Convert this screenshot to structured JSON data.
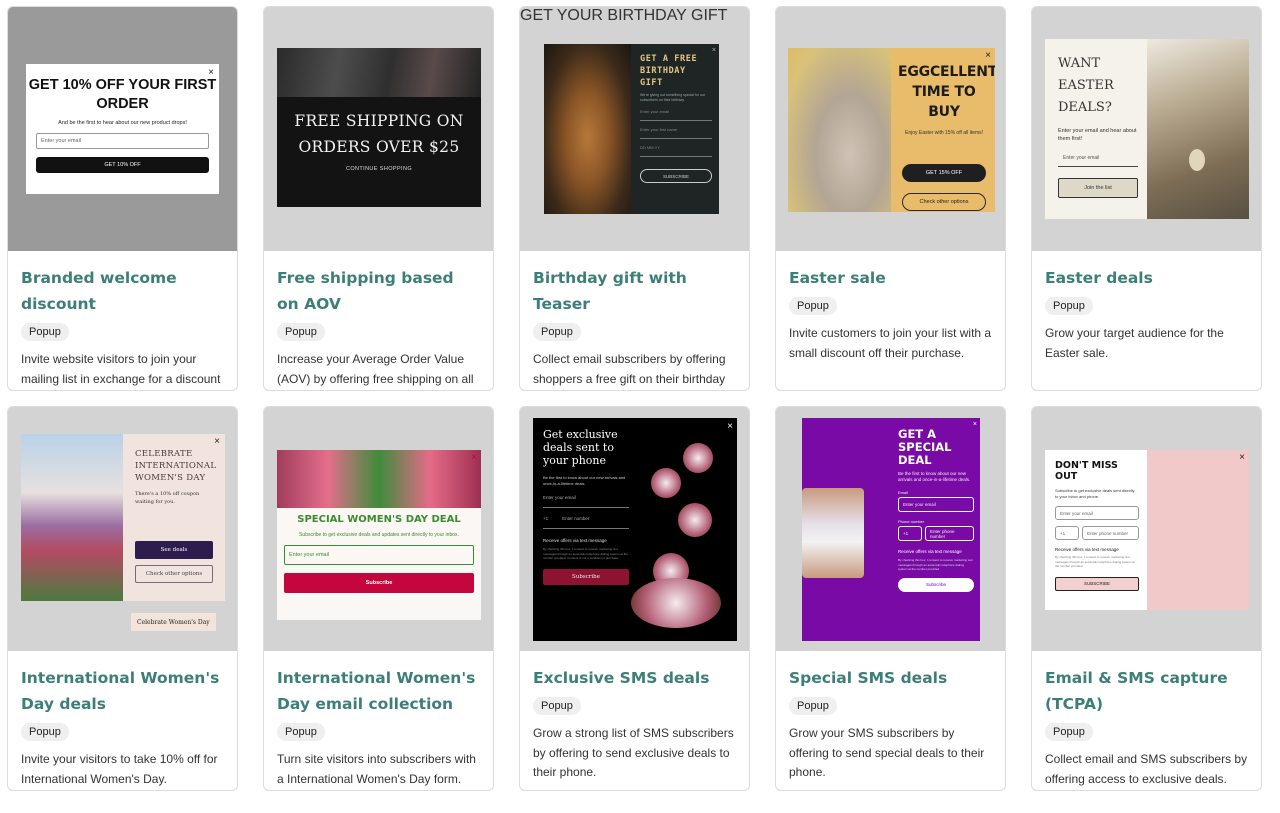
{
  "cards": [
    {
      "title": "Branded welcome discount",
      "badge": "Popup",
      "description": "Invite website visitors to join your mailing list in exchange for a discount on their first order.",
      "preview": {
        "heading": "GET 10% OFF YOUR FIRST ORDER",
        "subtext": "And be the first to hear about our new product drops!",
        "input_placeholder": "Enter your email",
        "button": "GET 10% OFF",
        "close": "×"
      }
    },
    {
      "title": "Free shipping based on AOV",
      "badge": "Popup",
      "description": "Increase your Average Order Value (AOV) by offering free shipping on all orders over a particular amount.",
      "preview": {
        "heading_line1": "FREE SHIPPING ON",
        "heading_line2": "ORDERS OVER $25",
        "button": "CONTINUE SHOPPING"
      }
    },
    {
      "title": "Birthday gift with Teaser",
      "badge": "Popup",
      "description": "Collect email subscribers by offering shoppers a free gift on their birthday enticing them with a teaser",
      "preview": {
        "heading": "GET A FREE BIRTHDAY GIFT",
        "subtext": "We're giving out something special for our subscribers on their birthday.",
        "email_placeholder": "Enter your email",
        "name_placeholder": "Enter your first name",
        "date_fields": "DD    MM    YY",
        "button": "SUBSCRIBE",
        "teaser": "GET YOUR BIRTHDAY GIFT",
        "close": "×"
      }
    },
    {
      "title": "Easter sale",
      "badge": "Popup",
      "description": "Invite customers to join your list with a small discount off their purchase.",
      "preview": {
        "heading": "EGGCELLENT TIME TO BUY",
        "subtext": "Enjoy Easter with 15% off all items!",
        "button_primary": "GET 15% OFF",
        "button_secondary": "Check other options",
        "close": "×"
      }
    },
    {
      "title": "Easter deals",
      "badge": "Popup",
      "description": "Grow your target audience for the Easter sale.",
      "preview": {
        "heading": "WANT EASTER DEALS?",
        "subtext": "Enter your email and hear about them first!",
        "input_placeholder": "Enter your email",
        "button": "Join the list"
      }
    },
    {
      "title": "International Women's Day deals",
      "badge": "Popup",
      "description": "Invite your visitors to take 10% off for International Women's Day.",
      "preview": {
        "heading": "CELEBRATE INTERNATIONAL WOMEN'S DAY",
        "subtext": "There's a 10% off coupon waiting for you.",
        "button_primary": "See deals",
        "button_secondary": "Check other options",
        "teaser": "Celebrate Women's Day",
        "close": "×"
      }
    },
    {
      "title": "International Women's Day email collection",
      "badge": "Popup",
      "description": "Turn site visitors into subscribers with a International Women's Day form.",
      "preview": {
        "heading": "SPECIAL WOMEN'S DAY DEAL",
        "subtext": "Subscribe to get exclusive deals and updates sent directly to your inbox.",
        "input_placeholder": "Enter your email",
        "button": "Subscribe",
        "close": "×"
      }
    },
    {
      "title": "Exclusive SMS deals",
      "badge": "Popup",
      "description": "Grow a strong list of SMS subscribers by offering to send exclusive deals to their phone.",
      "preview": {
        "heading": "Get exclusive deals sent to your phone",
        "subtext": "Be the first to know about our new arrivals and once-in-a-lifetime deals.",
        "email_placeholder": "Enter your email",
        "country_code": "+1",
        "phone_placeholder": "Enter number",
        "checkbox": "Receive offers via text message",
        "fine_print": "By checking this box, I consent to receive marketing text messages through an automatic telephone dialing system at the number provided. Consent is not a condition to purchase.",
        "button": "Subscribe",
        "close": "×"
      }
    },
    {
      "title": "Special SMS deals",
      "badge": "Popup",
      "description": "Grow your SMS subscribers by offering to send special deals to their phone.",
      "preview": {
        "heading": "GET A SPECIAL DEAL",
        "subtext": "Be the first to know about our new arrivals and once-in-a-lifetime deals.",
        "email_label": "Email",
        "email_placeholder": "Enter your email",
        "phone_label": "Phone number",
        "country_code": "+1",
        "phone_placeholder": "Enter phone number",
        "checkbox": "Receive offers via text message",
        "fine_print": "By checking this box, I consent to receive marketing text messages through an automatic telephone dialing system at the number provided.",
        "button": "Subscribe",
        "close": "×"
      }
    },
    {
      "title": "Email & SMS capture (TCPA)",
      "badge": "Popup",
      "description": "Collect email and SMS subscribers by offering access to exclusive deals.",
      "preview": {
        "heading": "DON'T MISS OUT",
        "subtext": "Subscribe to get exclusive deals sent directly to your inbox and phone.",
        "email_placeholder": "Enter your email",
        "country_code": "+1",
        "phone_placeholder": "Enter phone number",
        "checkbox": "Receive offers via text message",
        "fine_print": "By checking this box, I consent to receive marketing text messages through an automatic telephone dialing system at the number provided.",
        "button": "SUBSCRIBE",
        "close": "×"
      }
    }
  ]
}
